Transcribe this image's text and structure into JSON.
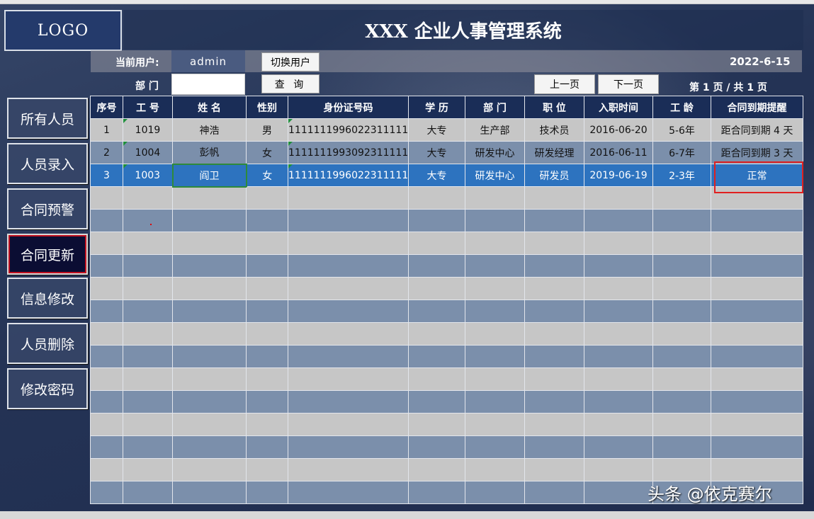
{
  "header": {
    "logo": "LOGO",
    "title": "XXX 企业人事管理系统"
  },
  "user_bar": {
    "current_user_label": "当前用户:",
    "current_user": "admin",
    "switch_user_label": "切换用户",
    "date": "2022-6-15"
  },
  "filter": {
    "dept_label": "部 门",
    "dept_value": "",
    "query_label": "查 询"
  },
  "pager": {
    "prev_label": "上一页",
    "next_label": "下一页",
    "page_info": "第 1 页 / 共 1 页"
  },
  "sidebar": {
    "items": [
      {
        "label": "所有人员"
      },
      {
        "label": "人员录入"
      },
      {
        "label": "合同预警"
      },
      {
        "label": "合同更新"
      },
      {
        "label": "信息修改"
      },
      {
        "label": "人员删除"
      },
      {
        "label": "修改密码"
      }
    ],
    "active_index": 3
  },
  "table": {
    "columns": [
      "序号",
      "工 号",
      "姓 名",
      "性别",
      "身份证号码",
      "学 历",
      "部 门",
      "职 位",
      "入职时间",
      "工 龄",
      "合同到期提醒"
    ],
    "rows": [
      [
        "1",
        "1019",
        "神浩",
        "男",
        "1111111996022311111",
        "大专",
        "生产部",
        "技术员",
        "2016-06-20",
        "5-6年",
        "距合同到期 4 天"
      ],
      [
        "2",
        "1004",
        "彭帆",
        "女",
        "1111111993092311111",
        "大专",
        "研发中心",
        "研发经理",
        "2016-06-11",
        "6-7年",
        "距合同到期 3 天"
      ],
      [
        "3",
        "1003",
        "阎卫",
        "女",
        "1111111996022311111",
        "大专",
        "研发中心",
        "研发员",
        "2019-06-19",
        "2-3年",
        "正常"
      ]
    ],
    "selected_row": 2,
    "empty_rows": 14
  },
  "watermark": "头条 @依克赛尔",
  "colors": {
    "header_bg": "#1a2d57",
    "selected_row": "#2d73bf",
    "row_gray": "#c6c6c6",
    "row_blue": "#7b8fab",
    "highlight_border": "#e02020"
  }
}
